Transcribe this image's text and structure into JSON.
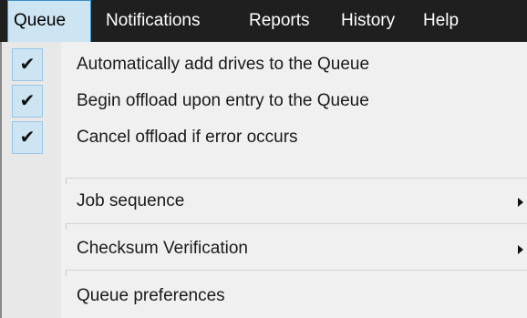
{
  "menubar": {
    "items": [
      "Queue",
      "Notifications",
      "Reports",
      "History",
      "Help"
    ]
  },
  "menu": {
    "check_glyph": "✔",
    "items": [
      {
        "label": "Automatically add drives to the Queue",
        "checked": true
      },
      {
        "label": "Begin offload upon entry to the Queue",
        "checked": true
      },
      {
        "label": "Cancel offload if error occurs",
        "checked": true
      },
      {
        "label": "Job sequence",
        "submenu": true
      },
      {
        "label": "Checksum Verification",
        "submenu": true
      },
      {
        "label": "Queue preferences"
      }
    ]
  },
  "colors": {
    "menubar_bg": "#1f1f1f",
    "active_item_bg": "#cde4f2",
    "active_item_border": "#3a8fc9",
    "menu_bg": "#f0f0f0"
  }
}
